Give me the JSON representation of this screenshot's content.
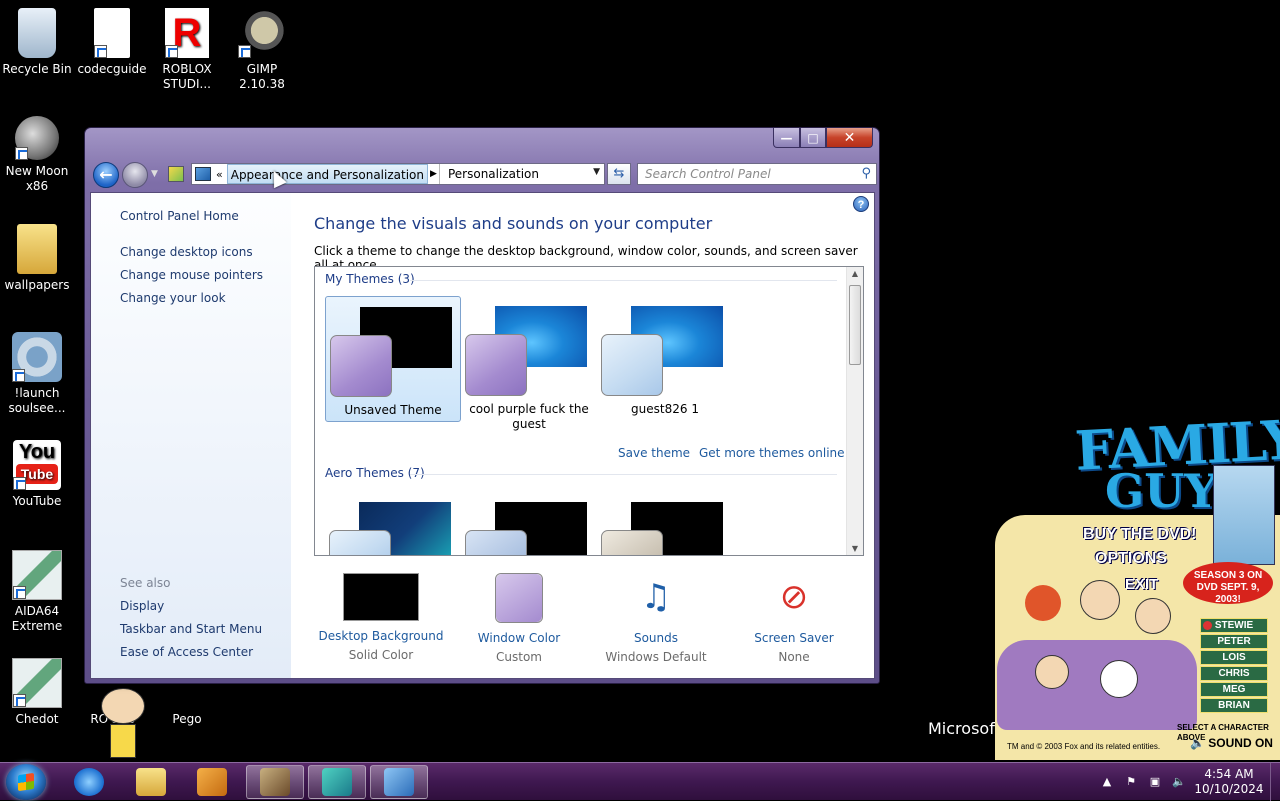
{
  "desktop": {
    "icons": [
      {
        "label": "Recycle Bin"
      },
      {
        "label": "codecguide"
      },
      {
        "label": "ROBLOX STUDI..."
      },
      {
        "label": "GIMP 2.10.38"
      },
      {
        "label": "New Moon x86"
      },
      {
        "label": "wallpapers"
      },
      {
        "label": "!launch soulsee..."
      },
      {
        "label": "YouTube"
      },
      {
        "label": "AIDA64 Extreme"
      },
      {
        "label": "Chedot"
      },
      {
        "label": "RO STU"
      },
      {
        "label": "Pego"
      }
    ],
    "background_text": "Microsoft"
  },
  "window": {
    "address": {
      "overflow_glyph": "«",
      "crumb1": "Appearance and Personalization",
      "crumb2": "Personalization"
    },
    "search_placeholder": "Search Control Panel",
    "left_pane": {
      "home": "Control Panel Home",
      "links": [
        "Change desktop icons",
        "Change mouse pointers",
        "Change your look"
      ],
      "see_also_label": "See also",
      "see_also": [
        "Display",
        "Taskbar and Start Menu",
        "Ease of Access Center"
      ]
    },
    "main": {
      "title": "Change the visuals and sounds on your computer",
      "description": "Click a theme to change the desktop background, window color, sounds, and screen saver all at once.",
      "my_themes_header": "My Themes (3)",
      "my_themes": [
        {
          "name": "Unsaved Theme",
          "selected": true
        },
        {
          "name": "cool purple fuck the guest",
          "selected": false
        },
        {
          "name": "guest826 1",
          "selected": false
        }
      ],
      "save_theme": "Save theme",
      "get_more_themes": "Get more themes online",
      "aero_themes_header": "Aero Themes (7)"
    },
    "bottom": [
      {
        "label": "Desktop Background",
        "value": "Solid Color"
      },
      {
        "label": "Window Color",
        "value": "Custom"
      },
      {
        "label": "Sounds",
        "value": "Windows Default"
      },
      {
        "label": "Screen Saver",
        "value": "None"
      }
    ]
  },
  "gadget": {
    "title_line1": "FAMILY",
    "title_line2": "GUY",
    "buy": "BUY THE DVD!",
    "options": "OPTIONS",
    "exit": "EXIT",
    "season": "SEASON 3 ON DVD SEPT. 9, 2003!",
    "characters": [
      "STEWIE",
      "PETER",
      "LOIS",
      "CHRIS",
      "MEG",
      "BRIAN"
    ],
    "select_text": "SELECT A CHARACTER ABOVE",
    "sound": "SOUND ON",
    "copyright": "TM and © 2003 Fox and its related entities."
  },
  "taskbar": {
    "time": "4:54 AM",
    "date": "10/10/2024"
  }
}
